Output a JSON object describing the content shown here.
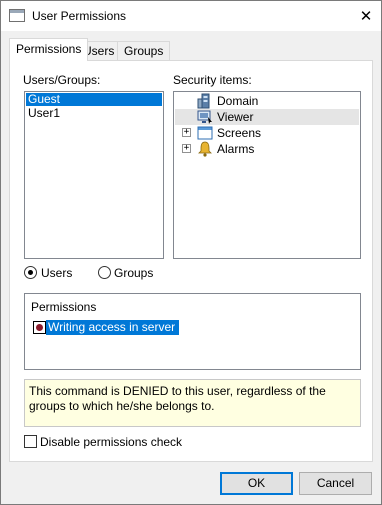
{
  "window": {
    "title": "User Permissions"
  },
  "tabs": [
    {
      "label": "Permissions",
      "active": true
    },
    {
      "label": "Users",
      "active": false
    },
    {
      "label": "Groups",
      "active": false
    }
  ],
  "users_groups": {
    "label": "Users/Groups:",
    "items": [
      {
        "label": "Guest",
        "selected": true
      },
      {
        "label": "User1",
        "selected": false
      }
    ]
  },
  "security_items": {
    "label": "Security items:",
    "items": [
      {
        "label": "Domain",
        "icon": "domain-icon",
        "expandable": false
      },
      {
        "label": "Viewer",
        "icon": "viewer-icon",
        "expandable": false,
        "highlighted": true
      },
      {
        "label": "Screens",
        "icon": "screens-icon",
        "expandable": true
      },
      {
        "label": "Alarms",
        "icon": "alarms-icon",
        "expandable": true
      }
    ]
  },
  "view_mode": {
    "users_label": "Users",
    "groups_label": "Groups",
    "selected": "Users"
  },
  "permissions": {
    "label": "Permissions",
    "items": [
      {
        "label": "Writing access in server",
        "state": "denied"
      }
    ]
  },
  "info": {
    "text": "This command is DENIED to this user, regardless of the groups to which he/she belongs to."
  },
  "disable_check": {
    "label": "Disable permissions check",
    "checked": false
  },
  "buttons": {
    "ok": "OK",
    "cancel": "Cancel"
  },
  "colors": {
    "selection": "#0078d7",
    "info_background": "#ffffe1",
    "denied_mark": "#8b1a2b"
  }
}
